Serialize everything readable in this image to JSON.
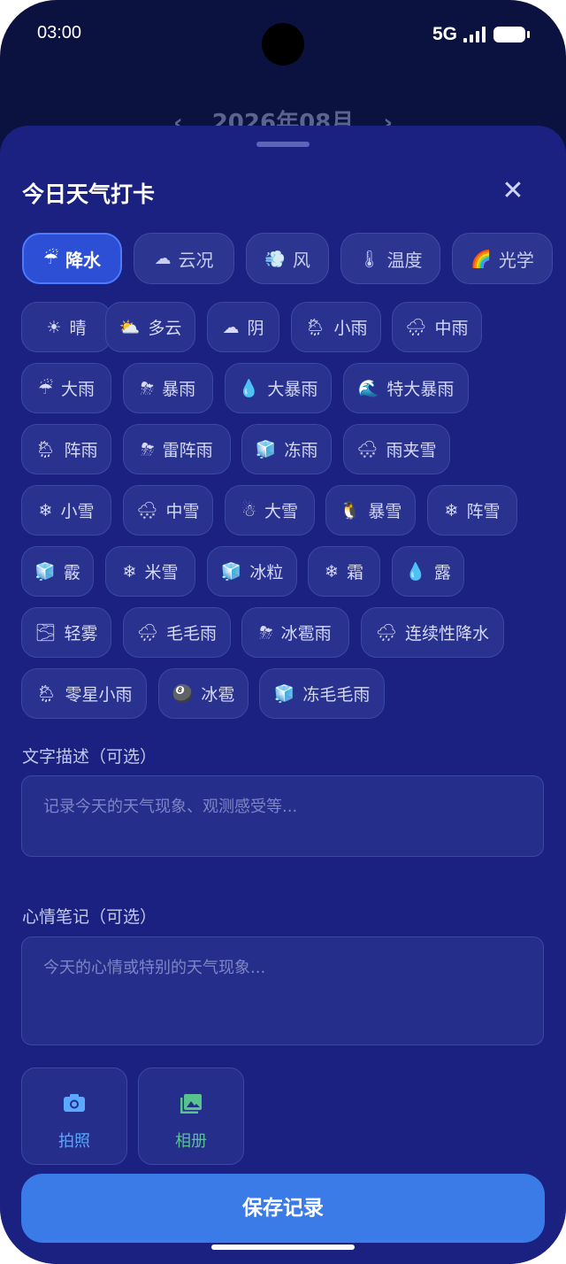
{
  "status": {
    "time": "03:00",
    "network": "5G"
  },
  "background": {
    "month": "2026年08月",
    "prev_icon": "chevron-left-icon",
    "next_icon": "chevron-right-icon"
  },
  "sheet": {
    "title": "今日天气打卡",
    "close_icon": "close-icon",
    "categories": [
      {
        "emoji": "☔",
        "label": "降水",
        "active": true
      },
      {
        "emoji": "☁",
        "label": "云况"
      },
      {
        "emoji": "💨",
        "label": "风"
      },
      {
        "emoji": "🌡",
        "label": "温度"
      },
      {
        "emoji": "🌈",
        "label": "光学"
      }
    ],
    "weather_rows": [
      [
        {
          "emoji": "☀",
          "label": "晴"
        },
        {
          "emoji": "⛅",
          "label": "多云"
        },
        {
          "emoji": "☁",
          "label": "阴"
        },
        {
          "emoji": "🌦",
          "label": "小雨"
        },
        {
          "emoji": "🌧",
          "label": "中雨"
        }
      ],
      [
        {
          "emoji": "☔",
          "label": "大雨"
        },
        {
          "emoji": "⛈",
          "label": "暴雨"
        },
        {
          "emoji": "💧",
          "label": "大暴雨"
        },
        {
          "emoji": "🌊",
          "label": "特大暴雨"
        }
      ],
      [
        {
          "emoji": "🌦",
          "label": "阵雨"
        },
        {
          "emoji": "⛈",
          "label": "雷阵雨"
        },
        {
          "emoji": "🧊",
          "label": "冻雨"
        },
        {
          "emoji": "🌨",
          "label": "雨夹雪"
        }
      ],
      [
        {
          "emoji": "❄",
          "label": "小雪"
        },
        {
          "emoji": "🌨",
          "label": "中雪"
        },
        {
          "emoji": "☃",
          "label": "大雪"
        },
        {
          "emoji": "🐧",
          "label": "暴雪"
        },
        {
          "emoji": "❄",
          "label": "阵雪"
        }
      ],
      [
        {
          "emoji": "🧊",
          "label": "霰"
        },
        {
          "emoji": "❄",
          "label": "米雪"
        },
        {
          "emoji": "🧊",
          "label": "冰粒"
        },
        {
          "emoji": "❄",
          "label": "霜"
        },
        {
          "emoji": "💧",
          "label": "露"
        }
      ],
      [
        {
          "emoji": "🌫",
          "label": "轻雾"
        },
        {
          "emoji": "🌧",
          "label": "毛毛雨"
        },
        {
          "emoji": "⛈",
          "label": "冰雹雨"
        },
        {
          "emoji": "🌧",
          "label": "连续性降水"
        }
      ],
      [
        {
          "emoji": "🌦",
          "label": "零星小雨"
        },
        {
          "emoji": "🎱",
          "label": "冰雹"
        },
        {
          "emoji": "🧊",
          "label": "冻毛毛雨"
        }
      ]
    ],
    "text_label": "文字描述（可选）",
    "text_placeholder": "记录今天的天气现象、观测感受等...",
    "mood_label": "心情笔记（可选）",
    "mood_placeholder": "今天的心情或特别的天气现象...",
    "photo": {
      "icon": "camera-icon",
      "label": "拍照",
      "color": "#5aa8ff"
    },
    "album": {
      "icon": "gallery-icon",
      "label": "相册",
      "color": "#57c48d"
    },
    "save_label": "保存记录"
  },
  "colors": {
    "sheet": "#1a2180",
    "accent": "#3a7be8"
  }
}
